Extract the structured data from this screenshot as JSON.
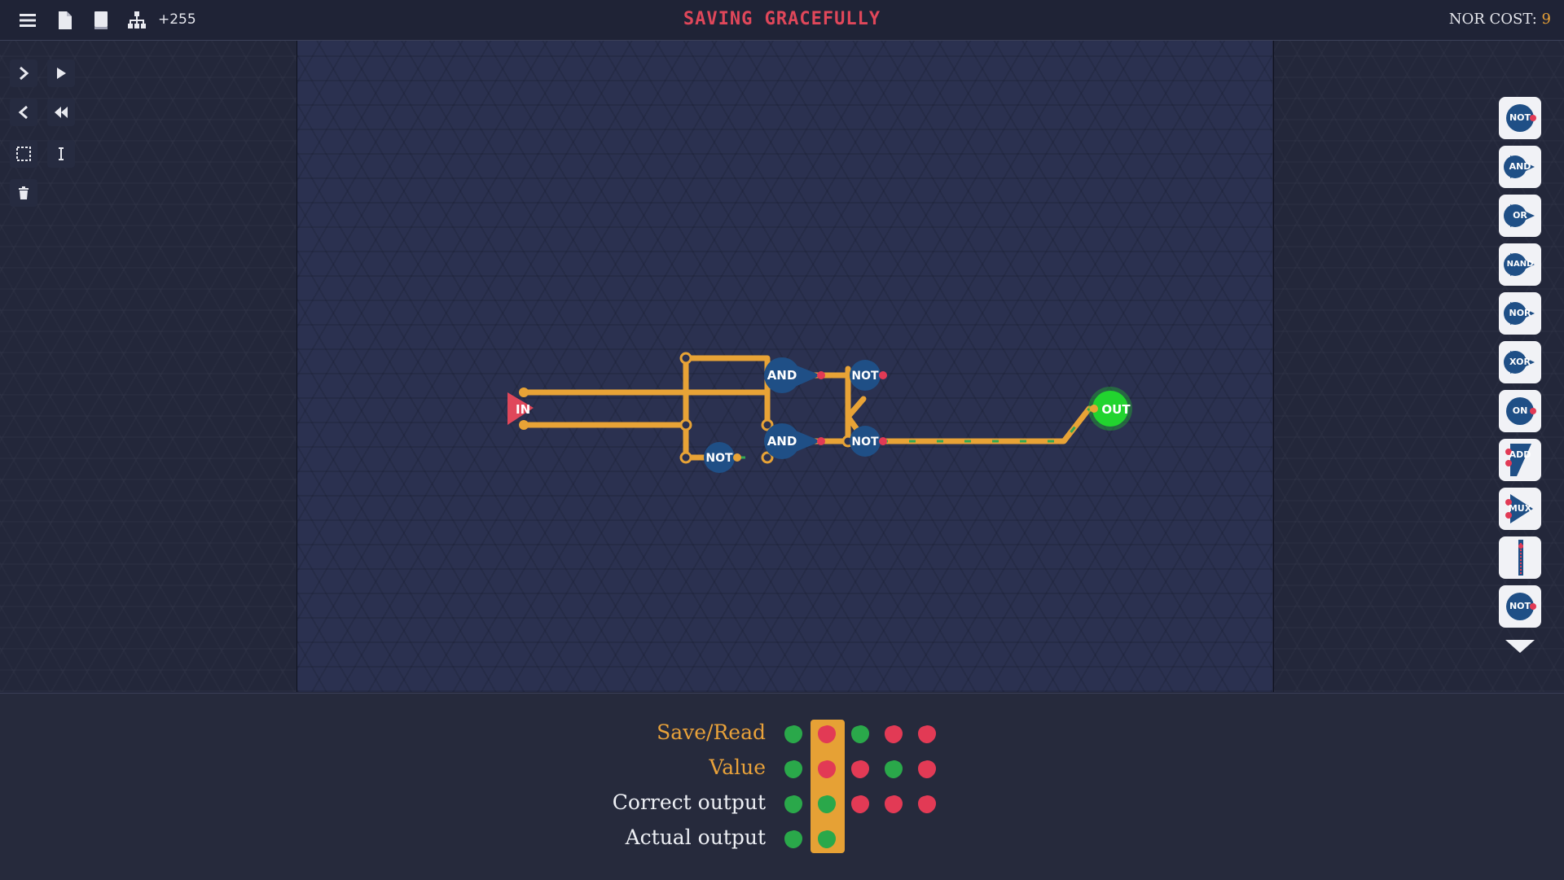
{
  "topbar": {
    "credits": "+255",
    "level_title": "SAVING GRACEFULLY",
    "nor_cost_label": "NOR COST:",
    "nor_cost_value": "9",
    "icons": [
      "menu-icon",
      "file-icon",
      "book-icon",
      "hierarchy-icon"
    ]
  },
  "tools": [
    "step-forward-icon",
    "play-icon",
    "step-back-icon",
    "rewind-icon",
    "select-box-icon",
    "wire-tool-icon",
    "trash-icon"
  ],
  "circuit": {
    "input_label": "IN",
    "output_label": "OUT",
    "gates": {
      "and_top": "AND",
      "and_bottom": "AND",
      "not_top": "NOT",
      "not_mid": "NOT",
      "not_low": "NOT"
    }
  },
  "palette": {
    "items": [
      {
        "label": "NOT",
        "shape": "circle"
      },
      {
        "label": "AND",
        "shape": "tri"
      },
      {
        "label": "OR",
        "shape": "tri"
      },
      {
        "label": "NAND",
        "shape": "tri"
      },
      {
        "label": "NOR",
        "shape": "tri"
      },
      {
        "label": "XOR",
        "shape": "tri"
      },
      {
        "label": "ON",
        "shape": "circle"
      },
      {
        "label": "ADD",
        "shape": "tri"
      },
      {
        "label": "MUX",
        "shape": "tri"
      },
      {
        "label": "",
        "shape": "split"
      },
      {
        "label": "NOT",
        "shape": "circle"
      }
    ]
  },
  "table": {
    "rows": [
      {
        "label": "Save/Read",
        "color": "orange",
        "values": [
          "green",
          "red",
          "green",
          "red",
          "red"
        ]
      },
      {
        "label": "Value",
        "color": "orange",
        "values": [
          "green",
          "red",
          "red",
          "green",
          "red"
        ]
      },
      {
        "label": "Correct output",
        "color": "white",
        "values": [
          "green",
          "green",
          "red",
          "red",
          "red"
        ]
      },
      {
        "label": "Actual output",
        "color": "white",
        "values": [
          "green",
          "green"
        ]
      }
    ],
    "highlighted_column": 1
  },
  "colors": {
    "accent_orange": "#e6a135",
    "title_red": "#e0475a",
    "on_green": "#2aa84a",
    "off_red": "#e23a55",
    "gate_blue": "#1f4f86",
    "output_green": "#22d42f"
  }
}
